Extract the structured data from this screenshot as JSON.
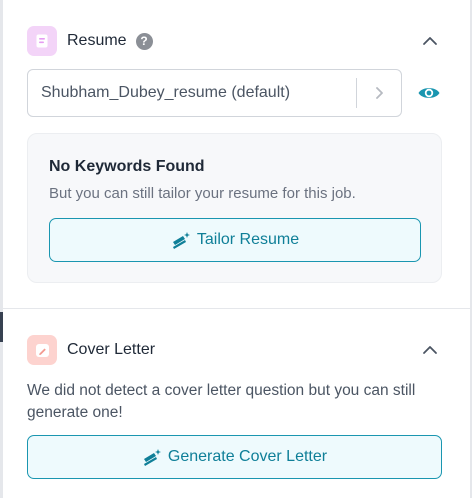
{
  "resume_section": {
    "title": "Resume",
    "help_icon": "?",
    "selected_resume": "Shubham_Dubey_resume (default)",
    "no_keywords_title": "No Keywords Found",
    "no_keywords_text": "But you can still tailor your resume for this job.",
    "tailor_button": "Tailor Resume"
  },
  "cover_section": {
    "title": "Cover Letter",
    "description": "We did not detect a cover letter question but you can still generate one!",
    "generate_button": "Generate Cover Letter"
  },
  "colors": {
    "accent": "#0f7f98",
    "button_bg": "#eefafd",
    "resume_icon_bg": "#f3d4f8",
    "cover_icon_bg": "#fdd3cf",
    "card_bg": "#f7f8fa"
  },
  "icons": {
    "resume": "document-icon",
    "cover": "edit-document-icon",
    "help": "help-icon",
    "collapse": "chevron-up-icon",
    "select_arrow": "chevron-right-icon",
    "preview": "eye-icon",
    "tailor": "magic-wand-icon"
  }
}
